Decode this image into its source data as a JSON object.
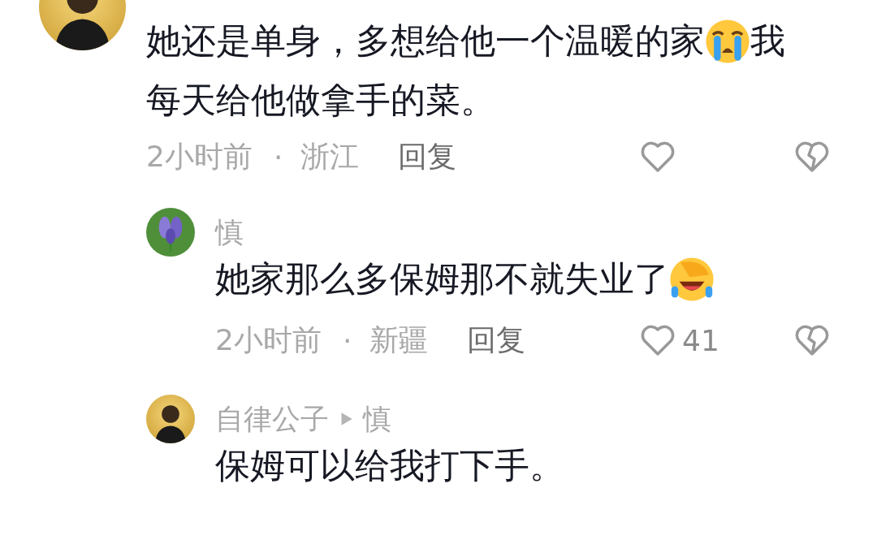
{
  "comments": [
    {
      "kind": "person",
      "lines": [
        [
          {
            "kind": "text",
            "text": "她还是单身，多想给他一个温暖的家"
          },
          {
            "kind": "crying-emoji"
          },
          {
            "kind": "text",
            "text": "我"
          }
        ],
        [
          {
            "kind": "text",
            "text": "每天给他做拿手的菜。"
          }
        ]
      ],
      "time": "2小时前",
      "separator": "·",
      "location": "浙江",
      "reply_label": "回复",
      "children": [
        {
          "kind": "flower",
          "name": "慎",
          "lines": [
            [
              {
                "kind": "text",
                "text": "她家那么多保姆那不就失业了"
              },
              {
                "kind": "laughing-emoji"
              }
            ]
          ],
          "time": "2小时前",
          "separator": "·",
          "location": "新疆",
          "reply_label": "回复",
          "likes": "41"
        },
        {
          "kind": "person",
          "name": "自律公子",
          "reply_to": "慎",
          "lines": [
            [
              {
                "kind": "text",
                "text": "保姆可以给我打下手。"
              }
            ]
          ]
        }
      ]
    }
  ]
}
